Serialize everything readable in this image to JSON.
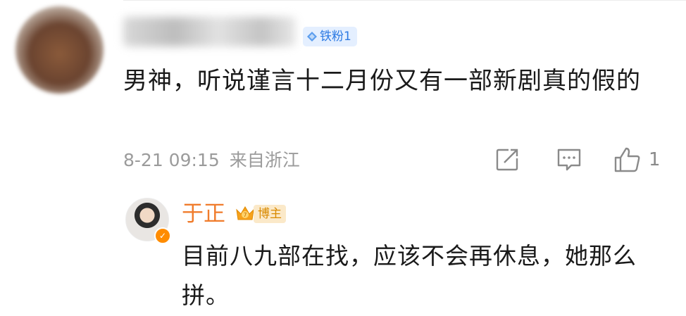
{
  "comment": {
    "badge_label": "铁粉1",
    "text": "男神，听说谨言十二月份又有一部新剧真的假的",
    "timestamp": "8-21 09:15",
    "location": "来自浙江",
    "like_count": "1"
  },
  "reply": {
    "author": "于正",
    "badge_label": "博主",
    "text": "目前八九部在找，应该不会再休息，她那么拼。"
  },
  "colors": {
    "fan_badge": "#2c7ae3",
    "author_name": "#f07c2c",
    "blogger_badge": "#d98a00"
  }
}
